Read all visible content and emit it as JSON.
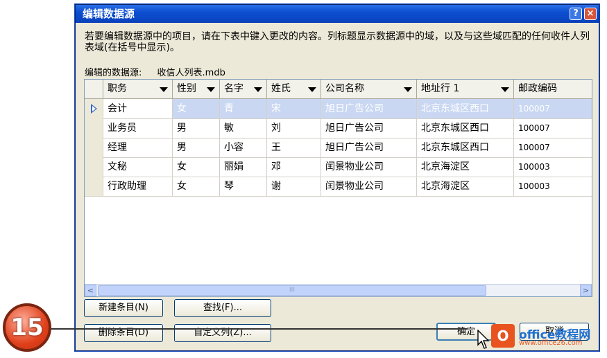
{
  "window": {
    "title": "编辑数据源",
    "help_label": "?",
    "close_label": "×"
  },
  "instruction": "若要编辑数据源中的项目，请在下表中键入更改的内容。列标题显示数据源中的域，以及与这些域匹配的任何收件人列表域(在括号中显示)。",
  "source": {
    "label": "编辑的数据源:",
    "value": "收信人列表.mdb"
  },
  "table": {
    "columns": [
      "职务",
      "性别",
      "名字",
      "姓氏",
      "公司名称",
      "地址行 1",
      "邮政编码"
    ],
    "rows": [
      [
        "会计",
        "女",
        "青",
        "宋",
        "旭日广告公司",
        "北京东城区西口",
        "100007"
      ],
      [
        "业务员",
        "男",
        "敏",
        "刘",
        "旭日广告公司",
        "北京东城区西口",
        "100007"
      ],
      [
        "经理",
        "男",
        "小容",
        "王",
        "旭日广告公司",
        "北京东城区西口",
        "100007"
      ],
      [
        "文秘",
        "女",
        "丽娟",
        "邓",
        "闰景物业公司",
        "北京海淀区",
        "100003"
      ],
      [
        "行政助理",
        "女",
        "琴",
        "谢",
        "闰景物业公司",
        "北京海淀区",
        "100003"
      ]
    ],
    "selected_row": 0
  },
  "scrollbar": {
    "left_arrow": "<",
    "right_arrow": ">",
    "thumb_grip": "III"
  },
  "buttons": {
    "new_entry": "新建条目(N)",
    "find": "查找(F)...",
    "delete_entry": "删除条目(D)",
    "custom_columns": "自定义列(Z)...",
    "ok": "确定",
    "cancel": "取消"
  },
  "step_badge": "15",
  "watermark": {
    "logo_letter": "O",
    "site_name": "office教程网",
    "url": "www.office26.com"
  },
  "colors": {
    "titlebar": "#0a46c4",
    "dialog_bg": "#ece9d8",
    "selection": "#c9d7f2",
    "badge": "#e0411c"
  }
}
